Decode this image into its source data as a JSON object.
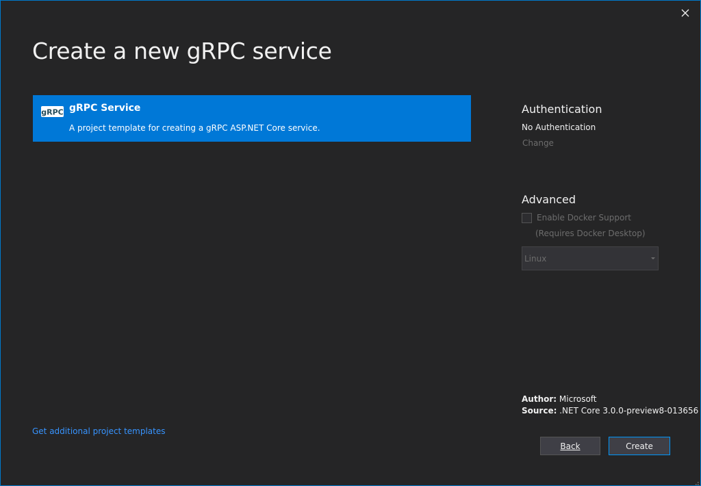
{
  "window": {
    "title": "Create a new gRPC service",
    "close_icon": "close-icon"
  },
  "templates": [
    {
      "icon": "grpc-logo-icon",
      "icon_text": "gRPC",
      "name": "gRPC Service",
      "description": "A project template for creating a gRPC ASP.NET Core service.",
      "selected": true
    }
  ],
  "get_more_link": "Get additional project templates",
  "authentication": {
    "heading": "Authentication",
    "value": "No Authentication",
    "change_label": "Change"
  },
  "advanced": {
    "heading": "Advanced",
    "docker_label": "Enable Docker Support",
    "docker_checked": false,
    "docker_note": "(Requires Docker Desktop)",
    "os_selected": "Linux"
  },
  "meta": {
    "author_label": "Author:",
    "author_value": "Microsoft",
    "source_label": "Source:",
    "source_value": ".NET Core 3.0.0-preview8-013656"
  },
  "buttons": {
    "back_label": "Back",
    "create_label": "Create"
  },
  "colors": {
    "background": "#252526",
    "accent": "#0078d7",
    "link": "#3794ff",
    "border": "#007acc"
  }
}
